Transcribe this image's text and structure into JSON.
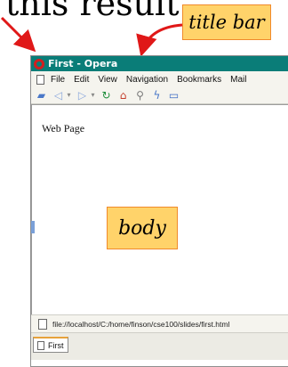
{
  "intro_text": "this result",
  "callouts": {
    "title_bar": "title bar",
    "body": "body"
  },
  "window": {
    "title": "First - Opera",
    "menu": [
      "File",
      "Edit",
      "View",
      "Navigation",
      "Bookmarks",
      "Mail"
    ],
    "toolbar_icons": [
      "open-icon",
      "back-icon",
      "forward-icon",
      "reload-icon",
      "home-icon",
      "search-icon",
      "magic-wand-icon",
      "panel-icon"
    ],
    "content_text": "Web Page",
    "address": "file://localhost/C:/home/finson/cse100/slides/first.html",
    "tab_title": "First"
  },
  "colors": {
    "title_bar": "#0a7d78",
    "callout_fill": "#ffd36a",
    "callout_border": "#f08a2b",
    "arrow": "#e01818"
  }
}
